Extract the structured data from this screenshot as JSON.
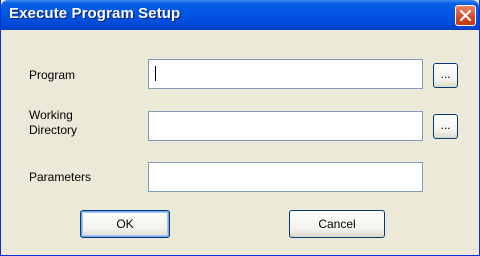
{
  "dialog": {
    "title": "Execute Program Setup",
    "close_label": "Close"
  },
  "fields": {
    "program": {
      "label": "Program",
      "value": "",
      "browse_label": "..."
    },
    "working_directory": {
      "label_line1": "Working",
      "label_line2": "Directory",
      "value": "",
      "browse_label": "..."
    },
    "parameters": {
      "label": "Parameters",
      "value": ""
    }
  },
  "buttons": {
    "ok": "OK",
    "cancel": "Cancel"
  },
  "colors": {
    "titlebar": "#0054E3",
    "window_bg": "#ECE9D8",
    "close_button": "#D8481F",
    "field_border": "#7F9DB9"
  }
}
